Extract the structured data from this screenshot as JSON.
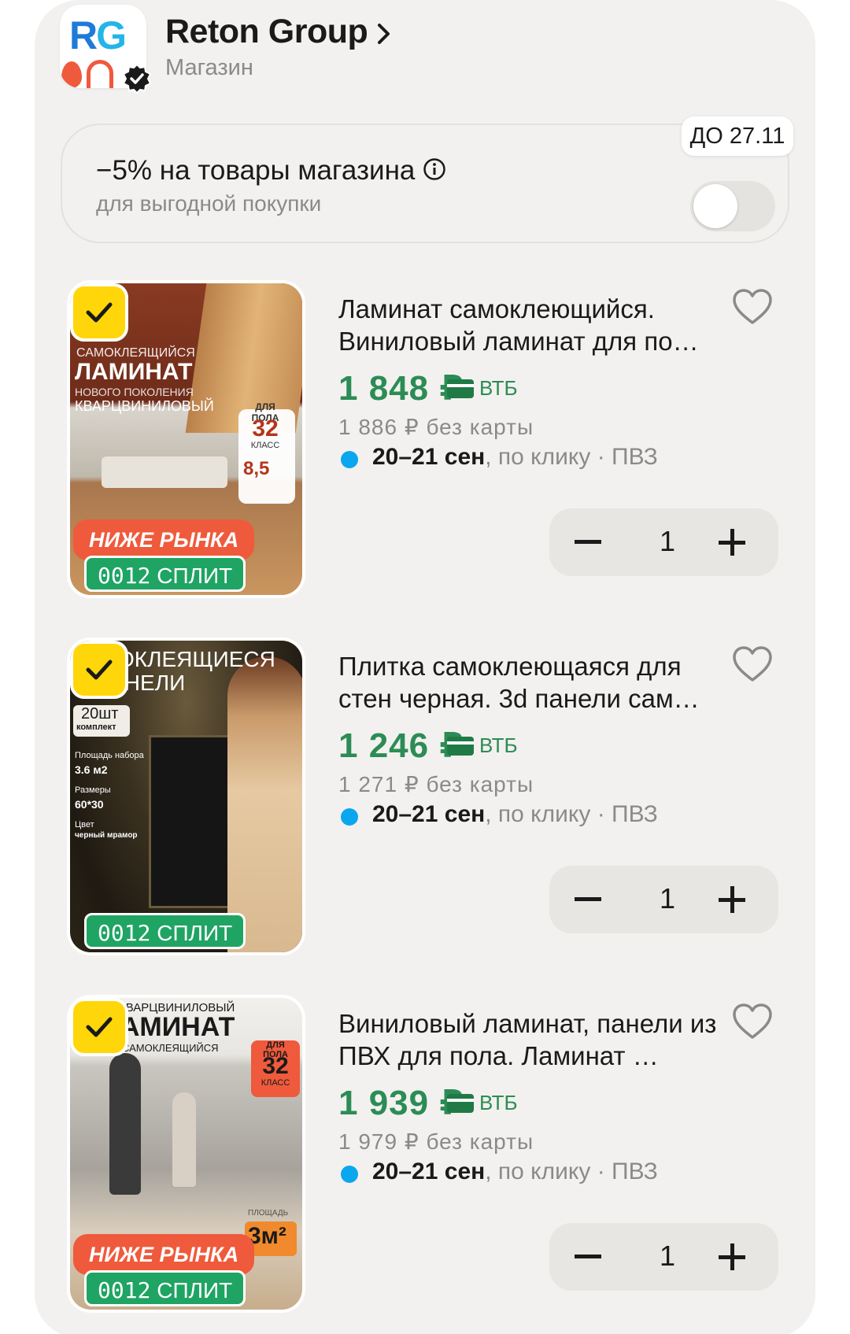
{
  "store": {
    "name": "Reton Group",
    "subtitle": "Магазин",
    "logo_text_r": "R",
    "logo_text_g": "G"
  },
  "promo": {
    "title": "−5% на товары магазина",
    "subtitle": "для выгодной покупки",
    "badge": "ДО 27.11",
    "toggle_on": false
  },
  "colors": {
    "price_green": "#2c8c55",
    "accent_yellow": "#ffd60a",
    "split_green": "#1fa463",
    "hook_orange": "#ef5a3c",
    "delivery_dot": "#0aa7ef"
  },
  "products": [
    {
      "name": "Ламинат самоклеющийся. Виниловый ламинат для по…",
      "price": "1 848 ₽",
      "bank": "ВТБ",
      "old_price": "1 886 ₽  без карты",
      "delivery_date": "20–21 сен",
      "delivery_rest": ", по клику · ПВЗ",
      "quantity": "1",
      "badge_hook": "НИЖЕ РЫНКА",
      "split_amount": "0012",
      "split_label": "СПЛИТ",
      "art": {
        "line1": "САМОКЛЕЯЩИЙСЯ",
        "line2": "ЛАМИНАТ",
        "line3": "НОВОГО ПОКОЛЕНИЯ",
        "line4": "КВАРЦВИНИЛОВЫЙ",
        "class_num": "32",
        "class_label": "КЛАСС",
        "floor_label": "ДЛЯ ПОЛА",
        "weight": "8,5"
      }
    },
    {
      "name": "Плитка самоклеющаяся для стен черная. 3d панели сам…",
      "price": "1 246 ₽",
      "bank": "ВТБ",
      "old_price": "1 271 ₽  без карты",
      "delivery_date": "20–21 сен",
      "delivery_rest": ", по клику · ПВЗ",
      "quantity": "1",
      "split_amount": "0012",
      "split_label": "СПЛИТ",
      "art": {
        "line1": "ОКЛЕЯЩИЕСЯ",
        "line2": "ПАНЕЛИ",
        "count": "20шт",
        "count_label": "комплект",
        "area_label": "Площадь набора",
        "area": "3.6 м2",
        "size_label": "Размеры",
        "size": "60*30",
        "color_label": "Цвет",
        "color": "черный мрамор"
      }
    },
    {
      "name": "Виниловый ламинат, панели из ПВХ для пола. Ламинат …",
      "price": "1 939 ₽",
      "bank": "ВТБ",
      "old_price": "1 979 ₽  без карты",
      "delivery_date": "20–21 сен",
      "delivery_rest": ", по клику · ПВЗ",
      "quantity": "1",
      "badge_hook": "НИЖЕ РЫНКА",
      "split_amount": "0012",
      "split_label": "СПЛИТ",
      "art": {
        "line1": "КВАРЦВИНИЛОВЫЙ",
        "line2": "ЛАМИНАТ",
        "line3": "САМОКЛЕЯЩИЙСЯ",
        "class_num": "32",
        "class_label": "КЛАСС",
        "floor_label": "ДЛЯ ПОЛА",
        "area": "3м²",
        "area_label": "ПЛОЩАДЬ"
      }
    }
  ]
}
